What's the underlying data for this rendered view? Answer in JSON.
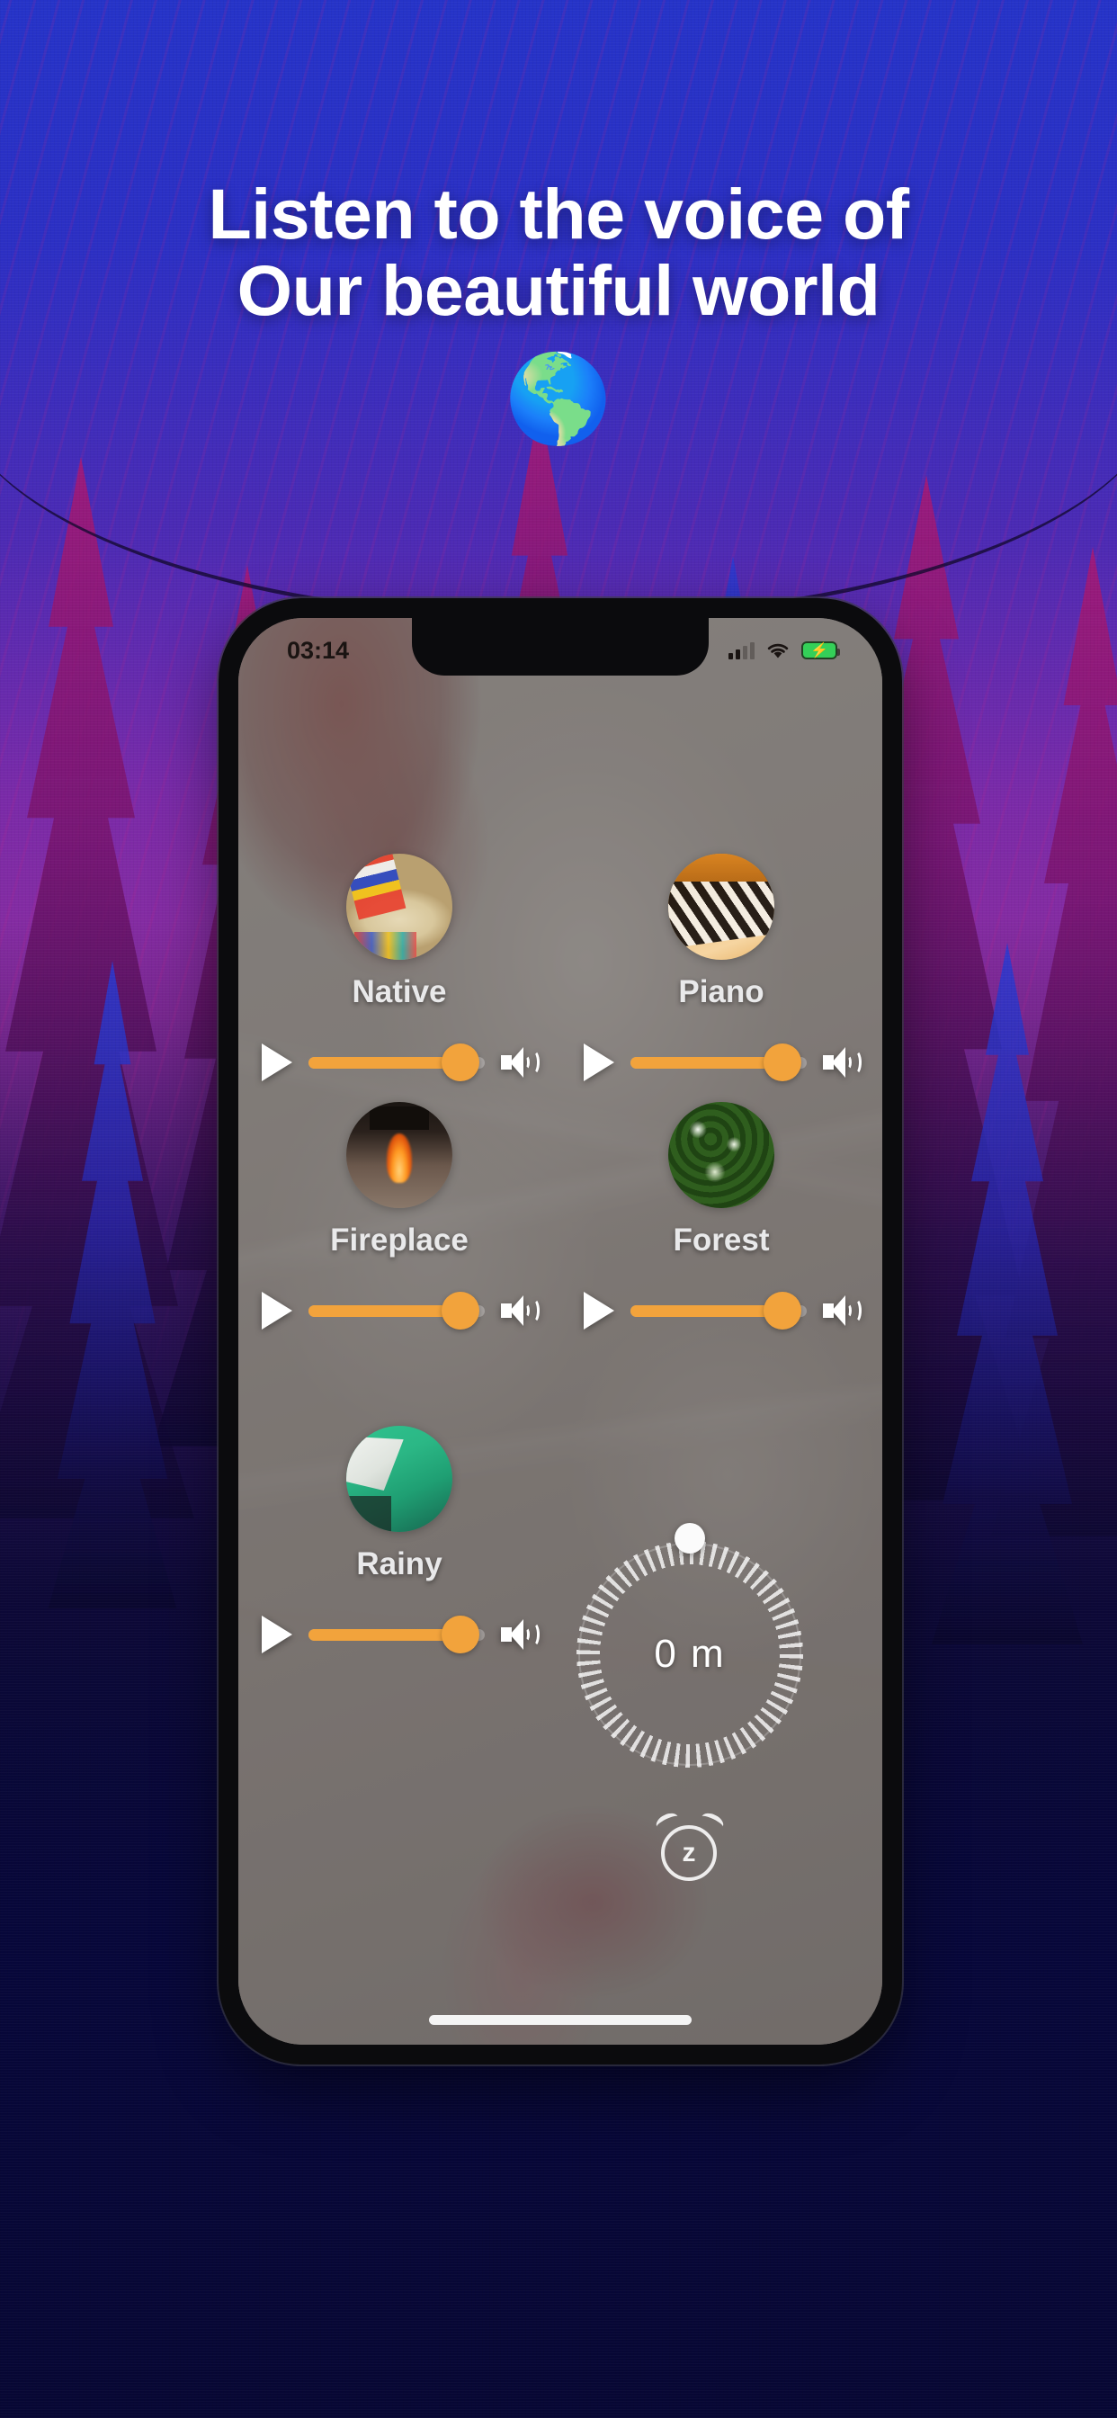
{
  "promo": {
    "headline_line1": "Listen to the voice of",
    "headline_line2": "Our beautiful world",
    "globe_emoji": "🌎"
  },
  "phone": {
    "status_bar": {
      "time": "03:14",
      "signal_icon": "cellular-signal-icon",
      "wifi_icon": "wifi-icon",
      "battery_icon": "battery-charging-icon",
      "battery_charging_glyph": "⚡"
    },
    "home_indicator": "home-indicator"
  },
  "app": {
    "accent_color": "#f2a33c",
    "sounds": [
      {
        "name": "Native",
        "play_icon": "play-icon",
        "volume_percent": 86,
        "speaker_icon": "speaker-icon",
        "thumb": "native-drum-thumbnail"
      },
      {
        "name": "Piano",
        "play_icon": "play-icon",
        "volume_percent": 86,
        "speaker_icon": "speaker-icon",
        "thumb": "piano-keys-thumbnail"
      },
      {
        "name": "Fireplace",
        "play_icon": "play-icon",
        "volume_percent": 86,
        "speaker_icon": "speaker-icon",
        "thumb": "fireplace-thumbnail"
      },
      {
        "name": "Forest",
        "play_icon": "play-icon",
        "volume_percent": 86,
        "speaker_icon": "speaker-icon",
        "thumb": "forest-trees-thumbnail"
      },
      {
        "name": "Rainy",
        "play_icon": "play-icon",
        "volume_percent": 86,
        "speaker_icon": "speaker-icon",
        "thumb": "rainy-thumbnail"
      }
    ],
    "timer": {
      "value": "0 m",
      "knob": "timer-dial-knob",
      "snooze_icon": "alarm-snooze-icon",
      "snooze_glyph": "z"
    }
  }
}
